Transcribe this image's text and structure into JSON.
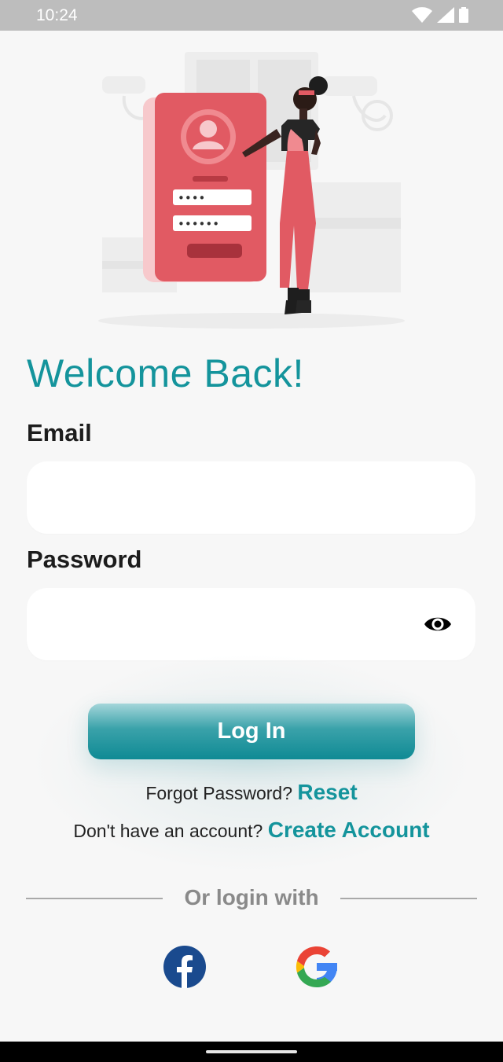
{
  "status_bar": {
    "time": "10:24",
    "icons": [
      "wifi-icon",
      "signal-icon",
      "battery-icon"
    ]
  },
  "illustration": {
    "name": "login-illustration",
    "pin_mask": "••••",
    "password_mask": "••••••"
  },
  "title": "Welcome Back!",
  "email": {
    "label": "Email",
    "value": "",
    "placeholder": ""
  },
  "password": {
    "label": "Password",
    "value": "",
    "placeholder": "",
    "toggle_icon": "eye-icon"
  },
  "login_button": "Log In",
  "forgot": {
    "text": "Forgot Password? ",
    "link": "Reset"
  },
  "signup": {
    "text": "Don't have an account? ",
    "link": "Create Account"
  },
  "divider_text": "Or login with",
  "social": [
    {
      "icon": "facebook-icon"
    },
    {
      "icon": "google-icon"
    }
  ],
  "colors": {
    "accent": "#14949c",
    "background": "#f7f7f7",
    "illustration_red": "#e15a63"
  }
}
